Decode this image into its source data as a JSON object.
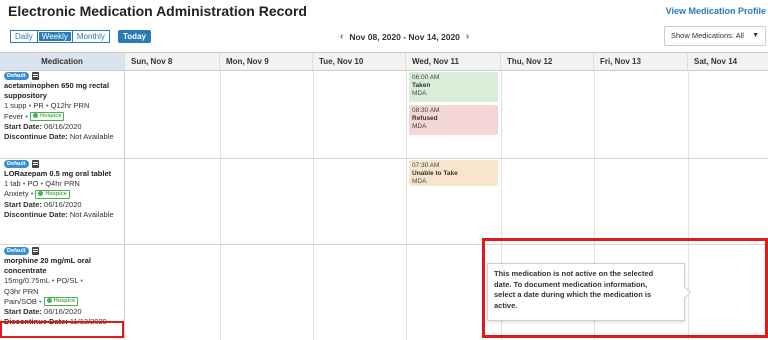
{
  "header": {
    "title": "Electronic Medication Administration Record",
    "profile_link": "View Medication Profile"
  },
  "toolbar": {
    "views": [
      "Daily",
      "Weekly",
      "Monthly"
    ],
    "active_view": "Weekly",
    "today_label": "Today",
    "date_range": "Nov 08, 2020 - Nov 14, 2020",
    "prev_icon": "chevron-left-icon",
    "next_icon": "chevron-right-icon",
    "show_medications": "Show Medications: All"
  },
  "columns": [
    "Medication",
    "Sun, Nov 8",
    "Mon, Nov 9",
    "Tue, Nov 10",
    "Wed, Nov 11",
    "Thu, Nov 12",
    "Fri, Nov 13",
    "Sat, Nov 14"
  ],
  "medications": [
    {
      "badge": "Default",
      "name_line1": "acetaminophen 650 mg rectal",
      "name_line2": "suppository",
      "dose": "1 supp",
      "route": "PR",
      "frequency": "Q12hr PRN",
      "indication": "Fever",
      "hospice": "Hospice",
      "start_label": "Start Date:",
      "start_date": "06/16/2020",
      "discontinue_label": "Discontinue Date:",
      "discontinue_date": "Not Available"
    },
    {
      "badge": "Default",
      "name_line1": "LORazepam 0.5 mg oral tablet",
      "dose": "1 tab",
      "route": "PO",
      "frequency": "Q4hr PRN",
      "indication": "Anxiety",
      "hospice": "Hospice",
      "start_label": "Start Date:",
      "start_date": "06/16/2020",
      "discontinue_label": "Discontinue Date:",
      "discontinue_date": "Not Available"
    },
    {
      "badge": "Default",
      "name_line1": "morphine 20 mg/mL oral",
      "name_line2": "concentrate",
      "dose": "15mg/0.75mL",
      "route": "PO/SL",
      "frequency": "Q3hr PRN",
      "indication": "Pain/SOB",
      "hospice": "Hospice",
      "start_label": "Start Date:",
      "start_date": "06/16/2020",
      "discontinue_label": "Discontinue Date:",
      "discontinue_date": "11/13/2020"
    }
  ],
  "administrations": [
    {
      "time": "06:00 AM",
      "status": "Taken",
      "by": "MDA",
      "type": "taken"
    },
    {
      "time": "08:30 AM",
      "status": "Refused",
      "by": "MDA",
      "type": "refused"
    },
    {
      "time": "07:30 AM",
      "status": "Unable to Take",
      "by": "MDA",
      "type": "unable"
    }
  ],
  "tooltip": {
    "line1": "This medication is not active on the selected",
    "line2": "date. To document medication information,",
    "line3": "select a date during which the medication is",
    "line4": "active."
  },
  "colors": {
    "accent": "#2a7ab8",
    "taken": "#d8eed8",
    "refused": "#f4d6d6",
    "unable": "#f8e6cc",
    "highlight": "#e01a1a",
    "hospice": "#4caf50"
  }
}
